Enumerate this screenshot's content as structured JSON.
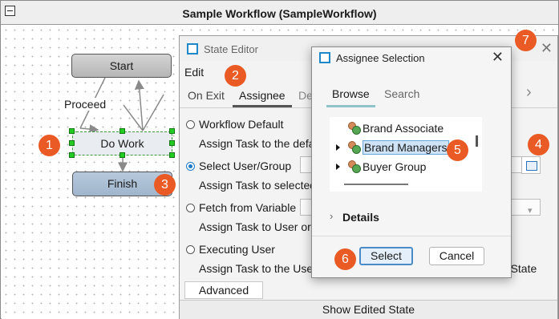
{
  "workflow": {
    "title": "Sample Workflow (SampleWorkflow)",
    "nodes": {
      "start": "Start",
      "work": "Do Work",
      "finish": "Finish"
    },
    "edge_label": "Proceed"
  },
  "state_editor": {
    "title": "State Editor",
    "menu_edit": "Edit",
    "tabs": [
      "On Exit",
      "Assignee",
      "De"
    ],
    "active_tab": "Assignee",
    "options": [
      {
        "label": "Workflow Default",
        "desc": "Assign Task to the defa",
        "selected": false
      },
      {
        "label": "Select User/Group",
        "desc": "Assign Task to selected",
        "selected": true
      },
      {
        "label": "Fetch from Variable",
        "desc": "Assign Task to User or G",
        "selected": false
      },
      {
        "label": "Executing User",
        "desc": "Assign Task to the User",
        "selected": false
      }
    ],
    "trailing_text": "nt State",
    "advanced_label": "Advanced",
    "show_edited_label": "Show Edited State"
  },
  "assignee_dialog": {
    "title": "Assignee Selection",
    "tabs": [
      "Browse",
      "Search"
    ],
    "active_tab": "Browse",
    "tree": [
      {
        "label": "Brand Associate",
        "expandable": false,
        "selected": false
      },
      {
        "label": "Brand Managers",
        "expandable": true,
        "selected": true
      },
      {
        "label": "Buyer Group",
        "expandable": true,
        "selected": false
      }
    ],
    "details_label": "Details",
    "select_label": "Select",
    "cancel_label": "Cancel"
  },
  "callouts": [
    "1",
    "2",
    "3",
    "4",
    "5",
    "6",
    "7"
  ],
  "colors": {
    "callout": "#ea5a24",
    "selection": "#cfe3f6",
    "accent": "#1e88c8"
  }
}
